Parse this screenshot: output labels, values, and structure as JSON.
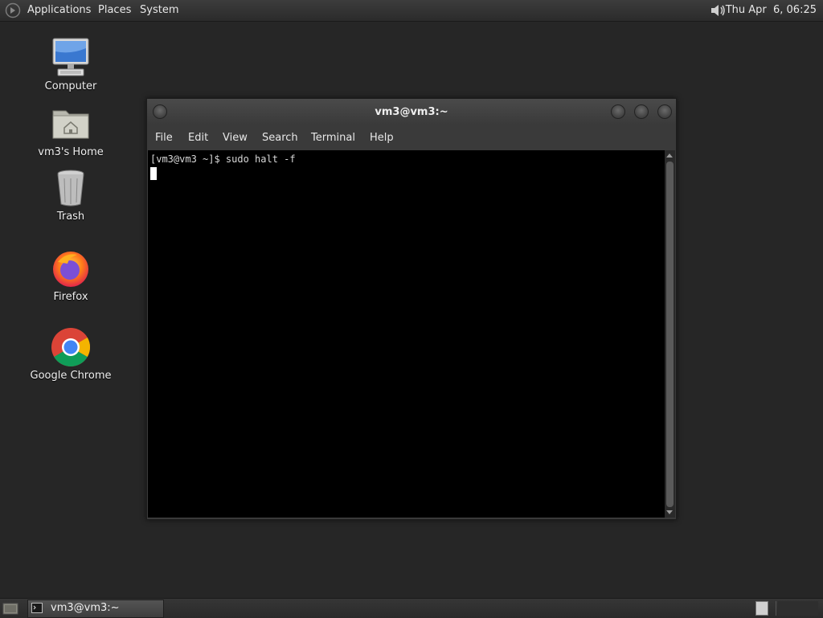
{
  "top_panel": {
    "menus": [
      "Applications",
      "Places",
      "System"
    ],
    "clock": "Thu Apr  6, 06:25",
    "icons": [
      "gnome-foot-icon",
      "volume-icon"
    ]
  },
  "desktop": {
    "icons": [
      {
        "label": "Computer",
        "icon": "computer-icon"
      },
      {
        "label": "vm3's Home",
        "icon": "home-folder-icon"
      },
      {
        "label": "Trash",
        "icon": "trash-icon"
      },
      {
        "label": "Firefox",
        "icon": "firefox-icon"
      },
      {
        "label": "Google Chrome",
        "icon": "chrome-icon"
      }
    ]
  },
  "terminal": {
    "title": "vm3@vm3:~",
    "menus": [
      "File",
      "Edit",
      "View",
      "Search",
      "Terminal",
      "Help"
    ],
    "lines": [
      "[vm3@vm3 ~]$ sudo halt -f"
    ]
  },
  "taskbar": {
    "tasks": [
      {
        "label": "vm3@vm3:~",
        "icon": "terminal-icon"
      }
    ]
  },
  "colors": {
    "desktop_bg": "#262626",
    "terminal_bg": "#000000",
    "terminal_fg": "#d8d8d8"
  }
}
